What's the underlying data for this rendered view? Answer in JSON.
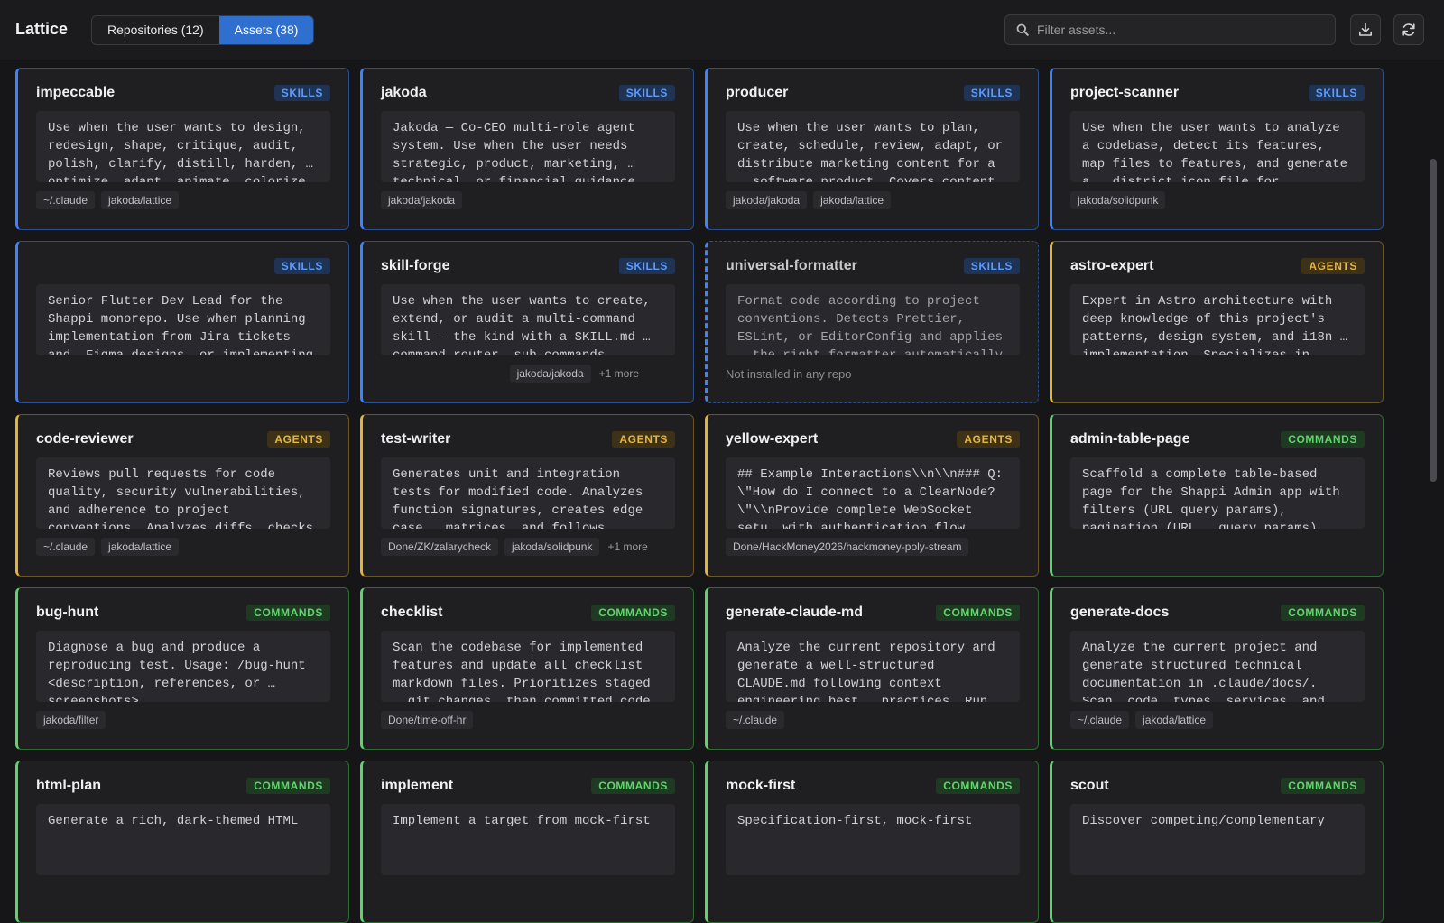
{
  "app": {
    "title": "Lattice"
  },
  "tabs": [
    {
      "label": "Repositories (12)",
      "active": false
    },
    {
      "label": "Assets (38)",
      "active": true
    }
  ],
  "search": {
    "placeholder": "Filter assets...",
    "value": ""
  },
  "toolbar": {
    "download_icon": "download-icon",
    "refresh_icon": "refresh-icon"
  },
  "colors": {
    "skills": "#3a84ff",
    "agents": "#e3b33a",
    "commands": "#5ed46a",
    "active_tab": "#2f6fd0"
  },
  "assets": [
    {
      "title": "impeccable",
      "type": "SKILLS",
      "desc": "Use when the user wants to design, redesign, shape, critique, audit, polish, clarify, distill, harden, … optimize, adapt, animate, colorize",
      "tags": [
        "~/.claude",
        "jakoda/lattice"
      ],
      "more": ""
    },
    {
      "title": "jakoda",
      "type": "SKILLS",
      "desc": "Jakoda — Co-CEO multi-role agent system. Use when the user needs strategic, product, marketing, … technical, or financial guidance for",
      "tags": [
        "jakoda/jakoda"
      ],
      "more": ""
    },
    {
      "title": "producer",
      "type": "SKILLS",
      "desc": "Use when the user wants to plan, create, schedule, review, adapt, or distribute marketing content for a … software product. Covers content",
      "tags": [
        "jakoda/jakoda",
        "jakoda/lattice"
      ],
      "more": ""
    },
    {
      "title": "project-scanner",
      "type": "SKILLS",
      "desc": "Use when the user wants to analyze a codebase, detect its features, map files to features, and generate a … district icon file for Solidpunk",
      "tags": [
        "jakoda/solidpunk"
      ],
      "more": ""
    },
    {
      "title": "",
      "type": "SKILLS",
      "desc": "Senior Flutter Dev Lead for the Shappi monorepo. Use when planning implementation from Jira tickets and… Figma designs, or implementing",
      "tags": [],
      "more": ""
    },
    {
      "title": "skill-forge",
      "type": "SKILLS",
      "desc": "Use when the user wants to create, extend, or audit a multi-command skill — the kind with a SKILL.md … command router, sub-commands",
      "tags": [
        "jakoda/jakoda"
      ],
      "more": "+1 more",
      "tags_right": true
    },
    {
      "title": "universal-formatter",
      "type": "SKILLS",
      "desc": "Format code according to project conventions. Detects Prettier, ESLint, or EditorConfig and applies … the right formatter automatically",
      "tags": [],
      "more": "",
      "not_installed": "Not installed in any repo",
      "dashed": true
    },
    {
      "title": "astro-expert",
      "type": "AGENTS",
      "desc": "Expert in Astro architecture with deep knowledge of this project's patterns, design system, and i18n … implementation. Specializes in",
      "tags": [],
      "more": ""
    },
    {
      "title": "code-reviewer",
      "type": "AGENTS",
      "desc": "Reviews pull requests for code quality, security vulnerabilities, and adherence to project conventions… Analyzes diffs, checks for anti",
      "tags": [
        "~/.claude",
        "jakoda/lattice"
      ],
      "more": ""
    },
    {
      "title": "test-writer",
      "type": "AGENTS",
      "desc": "Generates unit and integration tests for modified code. Analyzes function signatures, creates edge case … matrices, and follows existing test",
      "tags": [
        "Done/ZK/zalarycheck",
        "jakoda/solidpunk"
      ],
      "more": "+1 more"
    },
    {
      "title": "yellow-expert",
      "type": "AGENTS",
      "desc": "## Example Interactions\\\\n\\\\n### Q: \\\"How do I connect to a ClearNode?\\\"\\\\nProvide complete WebSocket setu… with authentication flow, including",
      "tags": [
        "Done/HackMoney2026/hackmoney-poly-stream"
      ],
      "more": ""
    },
    {
      "title": "admin-table-page",
      "type": "COMMANDS",
      "desc": "Scaffold a complete table-based page for the Shappi Admin app with filters (URL query params), pagination (URL … query params), sortable columns",
      "tags": [],
      "more": ""
    },
    {
      "title": "bug-hunt",
      "type": "COMMANDS",
      "desc": "Diagnose a bug and produce a reproducing test. Usage: /bug-hunt <description, references, or … screenshots>",
      "tags": [
        "jakoda/filter"
      ],
      "more": ""
    },
    {
      "title": "checklist",
      "type": "COMMANDS",
      "desc": "Scan the codebase for implemented features and update all checklist markdown files. Prioritizes staged … git changes, then committed code",
      "tags": [
        "Done/time-off-hr"
      ],
      "more": ""
    },
    {
      "title": "generate-claude-md",
      "type": "COMMANDS",
      "desc": "Analyze the current repository and generate a well-structured CLAUDE.md following context engineering best … practices. Run this in any repo to",
      "tags": [
        "~/.claude"
      ],
      "more": ""
    },
    {
      "title": "generate-docs",
      "type": "COMMANDS",
      "desc": "Analyze the current project and generate structured technical documentation in .claude/docs/. Scan… code, types, services, and components",
      "tags": [
        "~/.claude",
        "jakoda/lattice"
      ],
      "more": ""
    },
    {
      "title": "html-plan",
      "type": "COMMANDS",
      "desc": "Generate a rich, dark-themed HTML",
      "tags": [],
      "more": ""
    },
    {
      "title": "implement",
      "type": "COMMANDS",
      "desc": "Implement a target from mock-first",
      "tags": [],
      "more": ""
    },
    {
      "title": "mock-first",
      "type": "COMMANDS",
      "desc": "Specification-first, mock-first",
      "tags": [],
      "more": ""
    },
    {
      "title": "scout",
      "type": "COMMANDS",
      "desc": "Discover competing/complementary",
      "tags": [],
      "more": ""
    }
  ]
}
